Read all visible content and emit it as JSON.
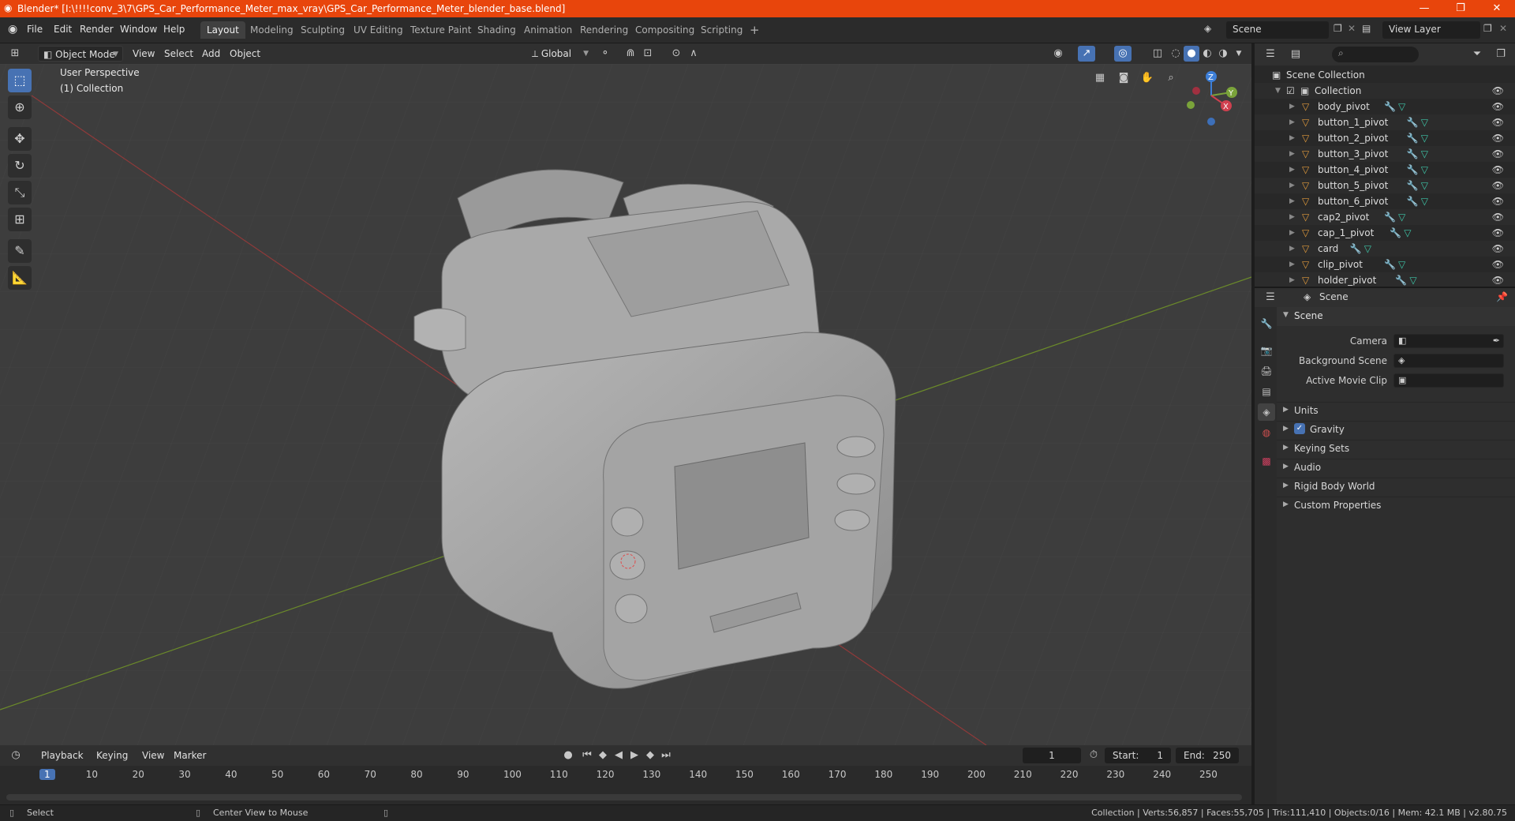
{
  "window": {
    "title": "Blender* [I:\\!!!!conv_3\\7\\GPS_Car_Performance_Meter_max_vray\\GPS_Car_Performance_Meter_blender_base.blend]",
    "minimize": "—",
    "maximize": "❐",
    "close": "✕"
  },
  "menu": {
    "items": [
      "File",
      "Edit",
      "Render",
      "Window",
      "Help"
    ],
    "workspaces": [
      "Layout",
      "Modeling",
      "Sculpting",
      "UV Editing",
      "Texture Paint",
      "Shading",
      "Animation",
      "Rendering",
      "Compositing",
      "Scripting"
    ],
    "add_workspace": "+",
    "scene_label": "Scene",
    "view_layer_label": "View Layer"
  },
  "viewport_header": {
    "mode": "Object Mode",
    "menus": [
      "View",
      "Select",
      "Add",
      "Object"
    ],
    "transform": "Global"
  },
  "viewport": {
    "perspective": "User Perspective",
    "collection": "(1) Collection",
    "gizmo": {
      "z": "Z",
      "y": "Y",
      "x": "X"
    }
  },
  "outliner": {
    "root": "Scene Collection",
    "collection": "Collection",
    "items": [
      "body_pivot",
      "button_1_pivot",
      "button_2_pivot",
      "button_3_pivot",
      "button_4_pivot",
      "button_5_pivot",
      "button_6_pivot",
      "cap2_pivot",
      "cap_1_pivot",
      "card",
      "clip_pivot",
      "holder_pivot"
    ]
  },
  "properties": {
    "context": "Scene",
    "panel_title": "Scene",
    "fields": [
      {
        "label": "Camera"
      },
      {
        "label": "Background Scene"
      },
      {
        "label": "Active Movie Clip"
      }
    ],
    "sections": [
      "Units",
      "Gravity",
      "Keying Sets",
      "Audio",
      "Rigid Body World",
      "Custom Properties"
    ],
    "gravity_checked": true
  },
  "timeline": {
    "menus": [
      "Playback",
      "Keying",
      "View",
      "Marker"
    ],
    "current_frame": "1",
    "start_label": "Start:",
    "start": "1",
    "end_label": "End:",
    "end": "250",
    "ticks": [
      "1",
      "10",
      "20",
      "30",
      "40",
      "50",
      "60",
      "70",
      "80",
      "90",
      "100",
      "110",
      "120",
      "130",
      "140",
      "150",
      "160",
      "170",
      "180",
      "190",
      "200",
      "210",
      "220",
      "230",
      "240",
      "250"
    ]
  },
  "status": {
    "select": "Select",
    "center_view": "Center View to Mouse",
    "stats": "Collection | Verts:56,857 | Faces:55,705 | Tris:111,410 | Objects:0/16 | Mem: 42.1 MB | v2.80.75"
  },
  "colors": {
    "title_bar": "#e8450c",
    "accent": "#4772b3",
    "object_icon": "#e09a3c",
    "mesh_icon": "#3ec6a8",
    "modifier_icon": "#6aa5e8"
  }
}
